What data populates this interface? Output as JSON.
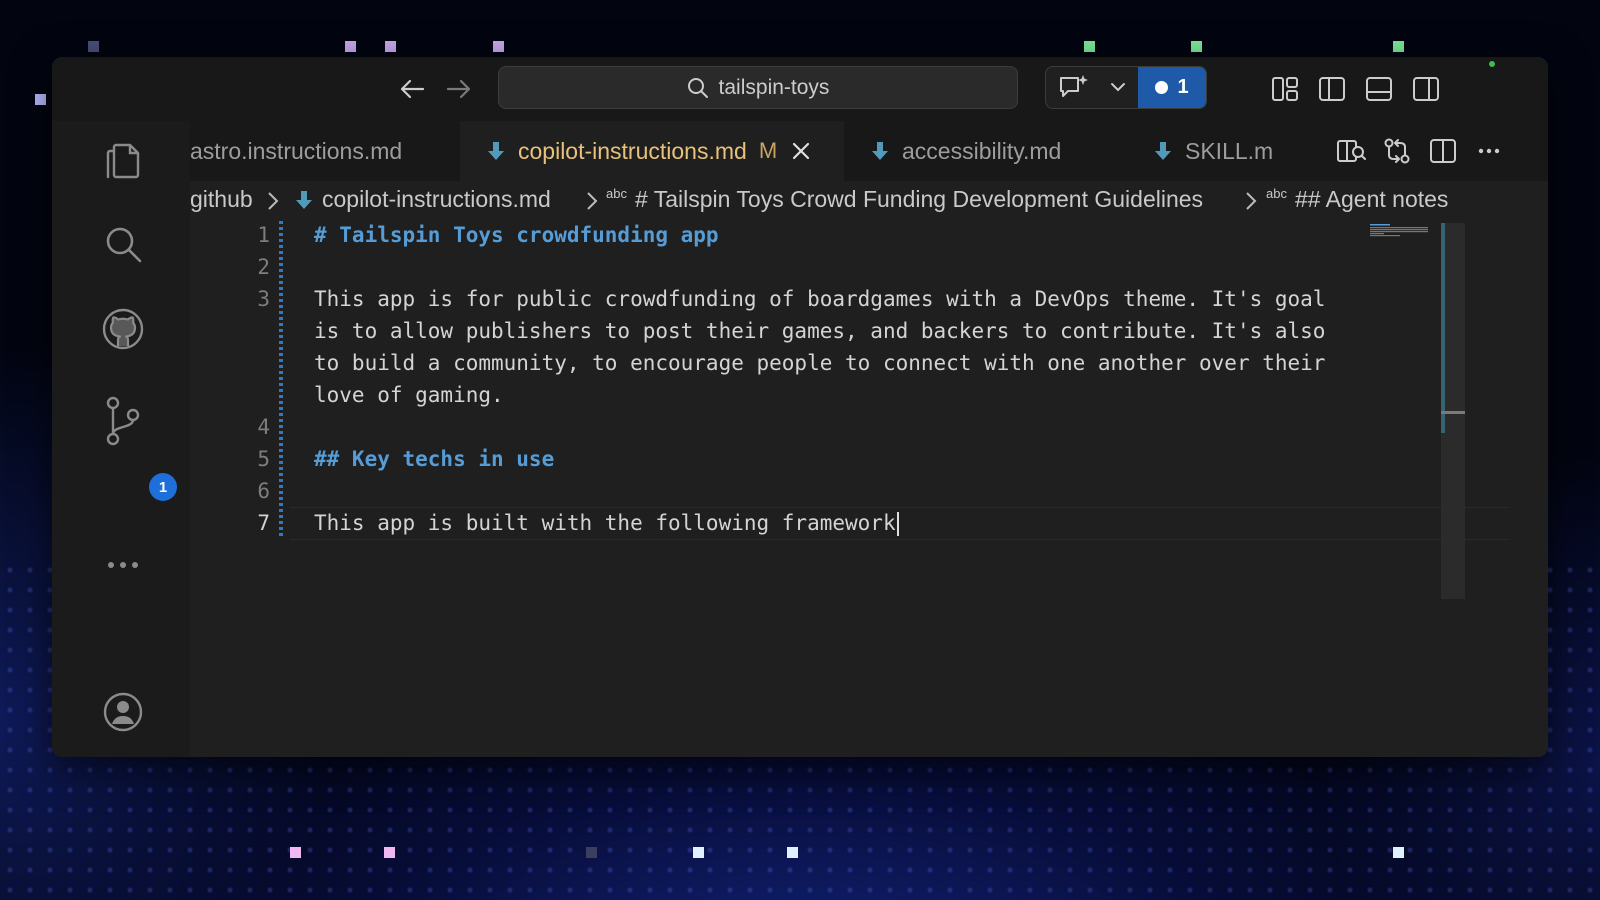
{
  "search": {
    "text": "tailspin-toys"
  },
  "copilot": {
    "changes_count": "1"
  },
  "activity": {
    "scm_badge": "1"
  },
  "tabs": [
    {
      "label": "astro.instructions.md",
      "modified": ""
    },
    {
      "label": "copilot-instructions.md",
      "modified": "M"
    },
    {
      "label": "accessibility.md",
      "modified": ""
    },
    {
      "label": "SKILL.m",
      "modified": ""
    }
  ],
  "breadcrumb": {
    "folder": "github",
    "file": "copilot-instructions.md",
    "abc": "abc",
    "h1": "# Tailspin Toys Crowd Funding Development Guidelines",
    "h2": "## Agent notes"
  },
  "editor": {
    "line_numbers": [
      "1",
      "2",
      "3",
      "4",
      "5",
      "6",
      "7"
    ],
    "lines": [
      "# Tailspin Toys crowdfunding app",
      "This app is for public crowdfunding of boardgames with a DevOps theme. It's goal",
      "is to allow publishers to post their games, and backers to contribute. It's also",
      "to build a community, to encourage people to connect with one another over their",
      "love of gaming.",
      "## Key techs in use",
      "This app is built with the following framework"
    ]
  },
  "colors": {
    "accent_blue": "#1e5aa8",
    "heading_blue": "#569cd6",
    "active_tab_text": "#e8c17a",
    "markdown_icon": "#519aba"
  }
}
